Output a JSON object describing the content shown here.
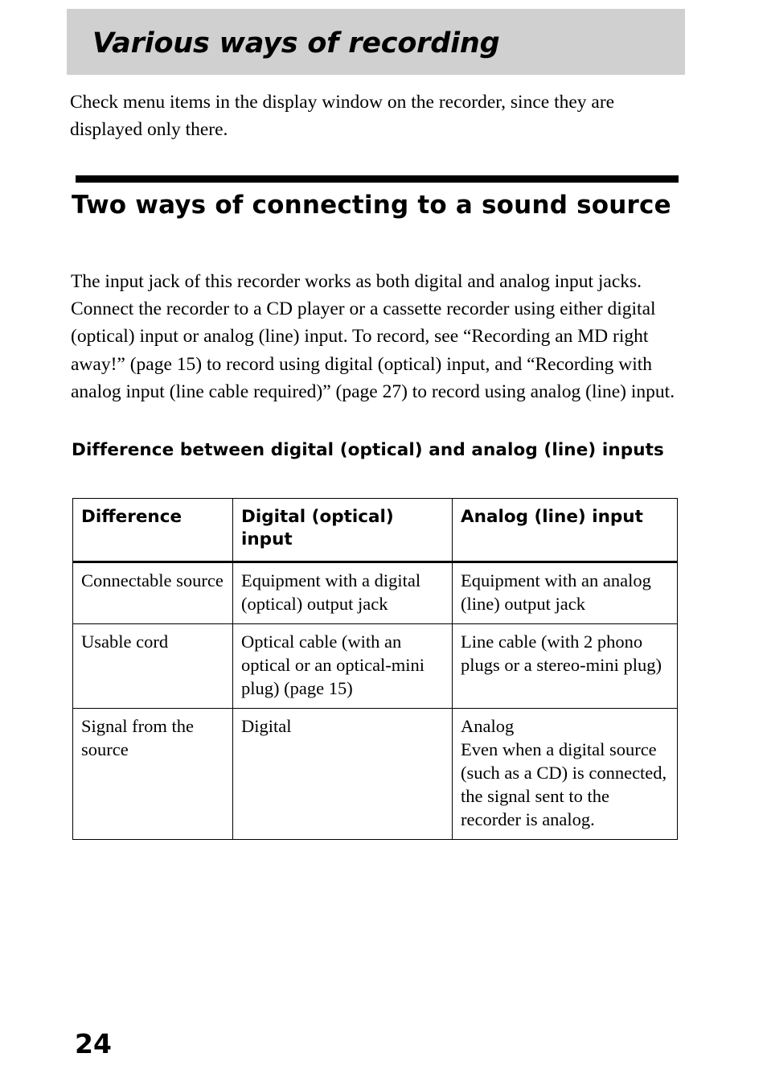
{
  "header": {
    "title": "Various ways of recording"
  },
  "intro": "Check menu items in the display window on the recorder, since they are displayed only there.",
  "section": {
    "heading": "Two ways of connecting to a sound source",
    "body": "The input jack of this recorder works as both digital and analog input jacks. Connect the recorder to a CD player or a cassette recorder using either digital (optical) input or analog (line) input. To record, see “Recording an MD right away!” (page 15) to record using digital (optical) input, and “Recording with analog input (line cable required)” (page 27) to record using analog (line) input.",
    "subheading": "Difference between digital (optical) and analog (line) inputs"
  },
  "table": {
    "headers": [
      "Difference",
      "Digital (optical) input",
      "Analog (line) input"
    ],
    "rows": [
      {
        "difference": "Connectable source",
        "digital": "Equipment with a digital (optical) output jack",
        "analog": "Equipment with an analog (line) output jack"
      },
      {
        "difference": "Usable cord",
        "digital": "Optical cable (with an optical or an optical-mini plug) (page 15)",
        "analog": "Line cable (with 2 phono plugs or a stereo-mini plug)"
      },
      {
        "difference": "Signal from the source",
        "digital": "Digital",
        "analog": "Analog\nEven when a digital source (such as a CD) is connected, the signal sent to the recorder is analog."
      }
    ]
  },
  "footer": {
    "page_number": "24"
  }
}
